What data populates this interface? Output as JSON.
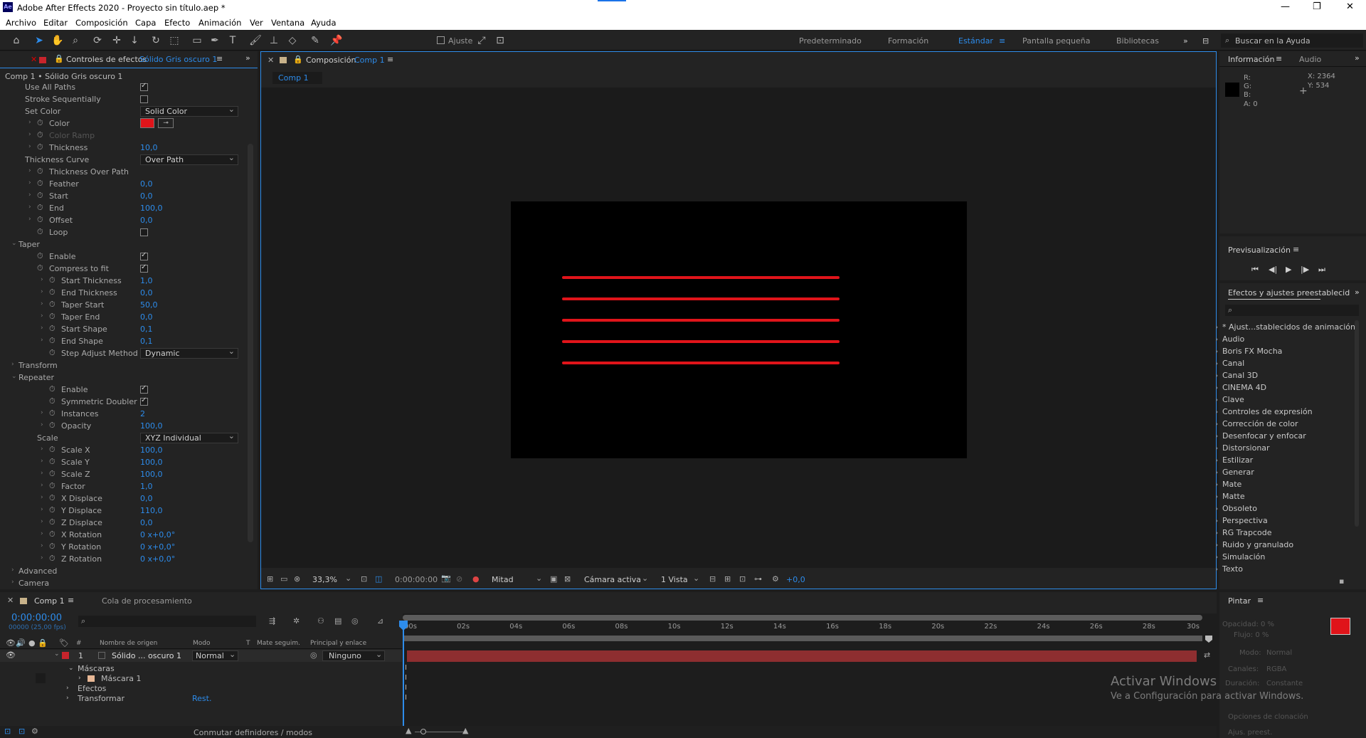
{
  "window": {
    "title": "Adobe After Effects 2020 - Proyecto sin título.aep *",
    "logo": "Ae"
  },
  "menu": [
    "Archivo",
    "Editar",
    "Composición",
    "Capa",
    "Efecto",
    "Animación",
    "Ver",
    "Ventana",
    "Ayuda"
  ],
  "toolbar": {
    "snap_label": "Ajuste",
    "workspaces": [
      "Predeterminado",
      "Formación",
      "Estándar",
      "Pantalla pequeña",
      "Bibliotecas"
    ],
    "active_workspace": "Estándar",
    "search_placeholder": "Buscar en la Ayuda"
  },
  "effects_panel": {
    "tab_label": "Controles de efectos",
    "tab_layer": "Sólido Gris oscuro 1",
    "breadcrumb": "Comp 1 • Sólido Gris oscuro 1",
    "rows": [
      {
        "name": "Use All Paths",
        "type": "check",
        "on": true,
        "indent": 1
      },
      {
        "name": "Stroke Sequentially",
        "type": "check",
        "on": false,
        "indent": 1
      },
      {
        "name": "Set Color",
        "type": "dropdown",
        "value": "Solid Color",
        "indent": 1
      },
      {
        "name": "Color",
        "type": "color",
        "indent": 2
      },
      {
        "name": "Color Ramp",
        "type": "disabled",
        "indent": 2
      },
      {
        "name": "Thickness",
        "type": "value",
        "value": "10,0",
        "indent": 2
      },
      {
        "name": "Thickness Curve",
        "type": "dropdown",
        "value": "Over Path",
        "indent": 1
      },
      {
        "name": "Thickness Over Path",
        "type": "label",
        "indent": 2
      },
      {
        "name": "Feather",
        "type": "value",
        "value": "0,0",
        "indent": 2
      },
      {
        "name": "Start",
        "type": "value",
        "value": "0,0",
        "indent": 2
      },
      {
        "name": "End",
        "type": "value",
        "value": "100,0",
        "indent": 2
      },
      {
        "name": "Offset",
        "type": "value",
        "value": "0,0",
        "indent": 2
      },
      {
        "name": "Loop",
        "type": "check",
        "on": false,
        "indent": 2
      },
      {
        "name": "Taper",
        "type": "group",
        "indent": 0
      },
      {
        "name": "Enable",
        "type": "check",
        "on": true,
        "indent": 3
      },
      {
        "name": "Compress to fit",
        "type": "check",
        "on": true,
        "indent": 3
      },
      {
        "name": "Start Thickness",
        "type": "value",
        "value": "1,0",
        "indent": 4
      },
      {
        "name": "End Thickness",
        "type": "value",
        "value": "0,0",
        "indent": 4
      },
      {
        "name": "Taper Start",
        "type": "value",
        "value": "50,0",
        "indent": 4
      },
      {
        "name": "Taper End",
        "type": "value",
        "value": "0,0",
        "indent": 4
      },
      {
        "name": "Start Shape",
        "type": "value",
        "value": "0,1",
        "indent": 4
      },
      {
        "name": "End Shape",
        "type": "value",
        "value": "0,1",
        "indent": 4
      },
      {
        "name": "Step Adjust Method",
        "type": "dropdown",
        "value": "Dynamic",
        "indent": 4
      },
      {
        "name": "Transform",
        "type": "group-closed",
        "indent": 0
      },
      {
        "name": "Repeater",
        "type": "group",
        "indent": 0
      },
      {
        "name": "Enable",
        "type": "check",
        "on": true,
        "indent": 5
      },
      {
        "name": "Symmetric Doubler",
        "type": "check",
        "on": true,
        "indent": 5
      },
      {
        "name": "Instances",
        "type": "value",
        "value": "2",
        "indent": 4
      },
      {
        "name": "Opacity",
        "type": "value",
        "value": "100,0",
        "indent": 4
      },
      {
        "name": "Scale",
        "type": "dropdown",
        "value": "XYZ Individual",
        "indent": 3
      },
      {
        "name": "Scale X",
        "type": "value",
        "value": "100,0",
        "indent": 4
      },
      {
        "name": "Scale Y",
        "type": "value",
        "value": "100,0",
        "indent": 4
      },
      {
        "name": "Scale Z",
        "type": "value",
        "value": "100,0",
        "indent": 4
      },
      {
        "name": "Factor",
        "type": "value",
        "value": "1,0",
        "indent": 4
      },
      {
        "name": "X Displace",
        "type": "value",
        "value": "0,0",
        "indent": 4
      },
      {
        "name": "Y Displace",
        "type": "value",
        "value": "110,0",
        "indent": 4
      },
      {
        "name": "Z Displace",
        "type": "value",
        "value": "0,0",
        "indent": 4
      },
      {
        "name": "X Rotation",
        "type": "value",
        "value": "0 x+0,0°",
        "indent": 4
      },
      {
        "name": "Y Rotation",
        "type": "value",
        "value": "0 x+0,0°",
        "indent": 4
      },
      {
        "name": "Z Rotation",
        "type": "value",
        "value": "0 x+0,0°",
        "indent": 4
      },
      {
        "name": "Advanced",
        "type": "group-closed",
        "indent": 0
      },
      {
        "name": "Camera",
        "type": "group-closed",
        "indent": 0
      }
    ]
  },
  "composition": {
    "tab_label": "Composición",
    "tab_comp": "Comp 1",
    "subtab": "Comp 1",
    "zoom": "33,3%",
    "timecode": "0:00:00:00",
    "resolution": "Mitad",
    "camera": "Cámara activa",
    "views": "1 Vista",
    "exposure": "+0,0",
    "line_color": "#e0141a",
    "line_count": 5
  },
  "info_panel": {
    "tabs": [
      "Información",
      "Audio"
    ],
    "r": "R:",
    "g": "G:",
    "b": "B:",
    "a": "A:  0",
    "x": "X:  2364",
    "y": "Y:  534"
  },
  "preview": {
    "title": "Previsualización"
  },
  "effects_presets": {
    "title": "Efectos y ajustes preestablecid",
    "items": [
      "* Ajust...stablecidos de animación",
      "Audio",
      "Boris FX Mocha",
      "Canal",
      "Canal 3D",
      "CINEMA 4D",
      "Clave",
      "Controles de expresión",
      "Corrección de color",
      "Desenfocar y enfocar",
      "Distorsionar",
      "Estilizar",
      "Generar",
      "Mate",
      "Matte",
      "Obsoleto",
      "Perspectiva",
      "RG Trapcode",
      "Ruido y granulado",
      "Simulación",
      "Texto"
    ]
  },
  "timeline": {
    "tab_comp": "Comp 1",
    "tab_queue": "Cola de procesamiento",
    "timecode": "0:00:00:00",
    "fps": "00000 (25,00 fps)",
    "columns": {
      "num": "#",
      "source": "Nombre de origen",
      "mode": "Modo",
      "t": "T",
      "track": "Mate seguim.",
      "parent": "Principal y enlace"
    },
    "layer": {
      "num": "1",
      "name": "Sólido ... oscuro 1",
      "mode": "Normal",
      "parent": "Ninguno"
    },
    "children": [
      "Máscaras",
      "Máscara 1",
      "Efectos",
      "Transformar"
    ],
    "reset": "Rest.",
    "ticks": [
      "00s",
      "02s",
      "04s",
      "06s",
      "08s",
      "10s",
      "12s",
      "14s",
      "16s",
      "18s",
      "20s",
      "22s",
      "24s",
      "26s",
      "28s",
      "30s"
    ],
    "footer": "Conmutar definidores / modos"
  },
  "paint": {
    "title": "Pintar",
    "opacity": "Opacidad:  0 %",
    "flow": "Flujo:  0 %",
    "mode_l": "Modo:",
    "mode_v": "Normal",
    "channels_l": "Canales:",
    "channels_v": "RGBA",
    "duration_l": "Duración:",
    "duration_v": "Constante",
    "clone": "Opciones de clonación",
    "preset": "Ajus. preest."
  },
  "watermark": {
    "line1": "Activar Windows",
    "line2": "Ve a Configuración para activar Windows."
  }
}
